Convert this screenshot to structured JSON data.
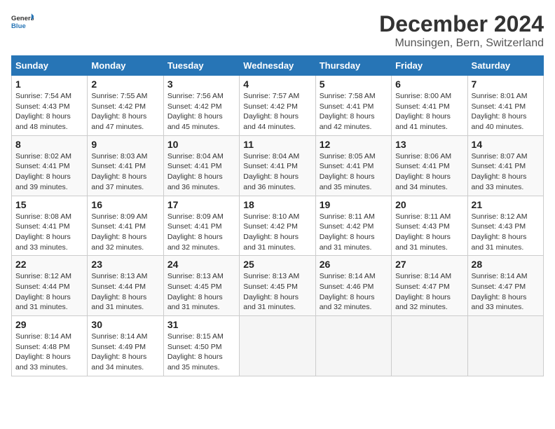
{
  "header": {
    "logo_line1": "General",
    "logo_line2": "Blue",
    "title": "December 2024",
    "subtitle": "Munsingen, Bern, Switzerland"
  },
  "days_of_week": [
    "Sunday",
    "Monday",
    "Tuesday",
    "Wednesday",
    "Thursday",
    "Friday",
    "Saturday"
  ],
  "weeks": [
    [
      {
        "day": "1",
        "sunrise": "7:54 AM",
        "sunset": "4:43 PM",
        "daylight": "8 hours and 48 minutes."
      },
      {
        "day": "2",
        "sunrise": "7:55 AM",
        "sunset": "4:42 PM",
        "daylight": "8 hours and 47 minutes."
      },
      {
        "day": "3",
        "sunrise": "7:56 AM",
        "sunset": "4:42 PM",
        "daylight": "8 hours and 45 minutes."
      },
      {
        "day": "4",
        "sunrise": "7:57 AM",
        "sunset": "4:42 PM",
        "daylight": "8 hours and 44 minutes."
      },
      {
        "day": "5",
        "sunrise": "7:58 AM",
        "sunset": "4:41 PM",
        "daylight": "8 hours and 42 minutes."
      },
      {
        "day": "6",
        "sunrise": "8:00 AM",
        "sunset": "4:41 PM",
        "daylight": "8 hours and 41 minutes."
      },
      {
        "day": "7",
        "sunrise": "8:01 AM",
        "sunset": "4:41 PM",
        "daylight": "8 hours and 40 minutes."
      }
    ],
    [
      {
        "day": "8",
        "sunrise": "8:02 AM",
        "sunset": "4:41 PM",
        "daylight": "8 hours and 39 minutes."
      },
      {
        "day": "9",
        "sunrise": "8:03 AM",
        "sunset": "4:41 PM",
        "daylight": "8 hours and 37 minutes."
      },
      {
        "day": "10",
        "sunrise": "8:04 AM",
        "sunset": "4:41 PM",
        "daylight": "8 hours and 36 minutes."
      },
      {
        "day": "11",
        "sunrise": "8:04 AM",
        "sunset": "4:41 PM",
        "daylight": "8 hours and 36 minutes."
      },
      {
        "day": "12",
        "sunrise": "8:05 AM",
        "sunset": "4:41 PM",
        "daylight": "8 hours and 35 minutes."
      },
      {
        "day": "13",
        "sunrise": "8:06 AM",
        "sunset": "4:41 PM",
        "daylight": "8 hours and 34 minutes."
      },
      {
        "day": "14",
        "sunrise": "8:07 AM",
        "sunset": "4:41 PM",
        "daylight": "8 hours and 33 minutes."
      }
    ],
    [
      {
        "day": "15",
        "sunrise": "8:08 AM",
        "sunset": "4:41 PM",
        "daylight": "8 hours and 33 minutes."
      },
      {
        "day": "16",
        "sunrise": "8:09 AM",
        "sunset": "4:41 PM",
        "daylight": "8 hours and 32 minutes."
      },
      {
        "day": "17",
        "sunrise": "8:09 AM",
        "sunset": "4:41 PM",
        "daylight": "8 hours and 32 minutes."
      },
      {
        "day": "18",
        "sunrise": "8:10 AM",
        "sunset": "4:42 PM",
        "daylight": "8 hours and 31 minutes."
      },
      {
        "day": "19",
        "sunrise": "8:11 AM",
        "sunset": "4:42 PM",
        "daylight": "8 hours and 31 minutes."
      },
      {
        "day": "20",
        "sunrise": "8:11 AM",
        "sunset": "4:43 PM",
        "daylight": "8 hours and 31 minutes."
      },
      {
        "day": "21",
        "sunrise": "8:12 AM",
        "sunset": "4:43 PM",
        "daylight": "8 hours and 31 minutes."
      }
    ],
    [
      {
        "day": "22",
        "sunrise": "8:12 AM",
        "sunset": "4:44 PM",
        "daylight": "8 hours and 31 minutes."
      },
      {
        "day": "23",
        "sunrise": "8:13 AM",
        "sunset": "4:44 PM",
        "daylight": "8 hours and 31 minutes."
      },
      {
        "day": "24",
        "sunrise": "8:13 AM",
        "sunset": "4:45 PM",
        "daylight": "8 hours and 31 minutes."
      },
      {
        "day": "25",
        "sunrise": "8:13 AM",
        "sunset": "4:45 PM",
        "daylight": "8 hours and 31 minutes."
      },
      {
        "day": "26",
        "sunrise": "8:14 AM",
        "sunset": "4:46 PM",
        "daylight": "8 hours and 32 minutes."
      },
      {
        "day": "27",
        "sunrise": "8:14 AM",
        "sunset": "4:47 PM",
        "daylight": "8 hours and 32 minutes."
      },
      {
        "day": "28",
        "sunrise": "8:14 AM",
        "sunset": "4:47 PM",
        "daylight": "8 hours and 33 minutes."
      }
    ],
    [
      {
        "day": "29",
        "sunrise": "8:14 AM",
        "sunset": "4:48 PM",
        "daylight": "8 hours and 33 minutes."
      },
      {
        "day": "30",
        "sunrise": "8:14 AM",
        "sunset": "4:49 PM",
        "daylight": "8 hours and 34 minutes."
      },
      {
        "day": "31",
        "sunrise": "8:15 AM",
        "sunset": "4:50 PM",
        "daylight": "8 hours and 35 minutes."
      },
      null,
      null,
      null,
      null
    ]
  ]
}
